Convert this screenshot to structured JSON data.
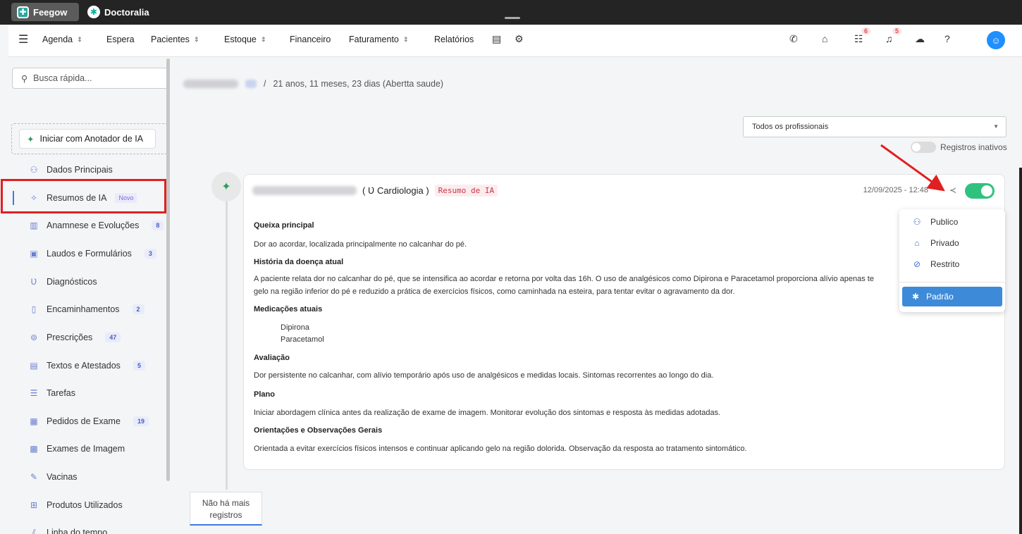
{
  "apps": [
    {
      "name": "Feegow",
      "icon": "feegow-logo-icon"
    },
    {
      "name": "Doctoralia",
      "icon": "doctoralia-logo-icon"
    }
  ],
  "nav": {
    "items": [
      "Agenda",
      "Espera",
      "Pacientes",
      "Estoque",
      "Financeiro",
      "Faturamento",
      "Relatórios"
    ],
    "badges": {
      "tasks": "6",
      "notifications": "5"
    }
  },
  "sidebar": {
    "search_placeholder": "Busca rápida...",
    "ai_button": "Iniciar com Anotador de IA",
    "items": [
      {
        "label": "Dados Principais",
        "icon": "user-icon",
        "count": ""
      },
      {
        "label": "Resumos de IA",
        "icon": "sparkle-icon",
        "count": "",
        "tag": "Novo"
      },
      {
        "label": "Anamnese e Evoluções",
        "icon": "chart-icon",
        "count": "8"
      },
      {
        "label": "Laudos e Formulários",
        "icon": "clipboard-icon",
        "count": "3"
      },
      {
        "label": "Diagnósticos",
        "icon": "stethoscope-icon",
        "count": ""
      },
      {
        "label": "Encaminhamentos",
        "icon": "document-icon",
        "count": "2"
      },
      {
        "label": "Prescrições",
        "icon": "pills-icon",
        "count": "47"
      },
      {
        "label": "Textos e Atestados",
        "icon": "text-doc-icon",
        "count": "5"
      },
      {
        "label": "Tarefas",
        "icon": "list-icon",
        "count": ""
      },
      {
        "label": "Pedidos de Exame",
        "icon": "lab-icon",
        "count": "19"
      },
      {
        "label": "Exames de Imagem",
        "icon": "image-icon",
        "count": ""
      },
      {
        "label": "Vacinas",
        "icon": "syringe-icon",
        "count": ""
      },
      {
        "label": "Produtos Utilizados",
        "icon": "box-icon",
        "count": ""
      },
      {
        "label": "Linha do tempo",
        "icon": "timeline-icon",
        "count": ""
      }
    ]
  },
  "patient": {
    "age": "21 anos, 11 meses, 23 dias (Abertta saude)",
    "separator": "/"
  },
  "filters": {
    "professional_select": "Todos os profissionais",
    "inactive_label": "Registros inativos"
  },
  "record": {
    "specialty": "( Ʋ Cardiologia )",
    "tag": "Resumo de IA",
    "date": "12/09/2025 - 12:48",
    "sections": [
      {
        "title": "Queixa principal",
        "text": "Dor ao acordar, localizada principalmente no calcanhar do pé."
      },
      {
        "title": "História da doença atual",
        "text": "A paciente relata dor no calcanhar do pé, que se intensifica ao acordar e retorna por volta das 16h. O uso de analgésicos como Dipirona e Paracetamol proporciona alívio apenas te",
        "text2": "gelo na região inferior do pé e reduzido a prática de exercícios físicos, como caminhada na esteira, para tentar evitar o agravamento da dor."
      },
      {
        "title": "Medicações atuais",
        "items": [
          "Dipirona",
          "Paracetamol"
        ]
      },
      {
        "title": "Avaliação",
        "text": "Dor persistente no calcanhar, com alívio temporário após uso de analgésicos e medidas locais. Sintomas recorrentes ao longo do dia."
      },
      {
        "title": "Plano",
        "text": "Iniciar abordagem clínica antes da realização de exame de imagem. Monitorar evolução dos sintomas e resposta às medidas adotadas."
      },
      {
        "title": "Orientações e Observações Gerais",
        "text": "Orientada a evitar exercícios físicos intensos e continuar aplicando gelo na região dolorida. Observação da resposta ao tratamento sintomático."
      }
    ]
  },
  "visibility_menu": {
    "options": [
      "Publico",
      "Privado",
      "Restrito"
    ],
    "active": "Padrão"
  },
  "footer": {
    "no_more": "Não há mais registros"
  },
  "colors": {
    "accent": "#3d7ae0",
    "toggle_on": "#2ec27e",
    "highlight_box": "#e02020",
    "arrow": "#e02020"
  }
}
